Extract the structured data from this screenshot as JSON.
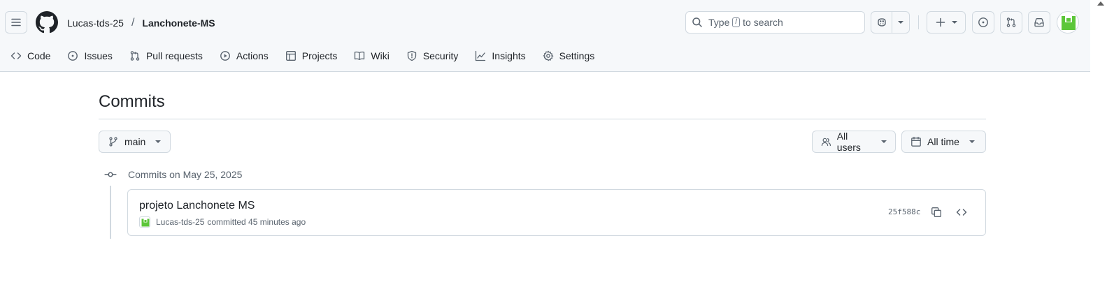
{
  "header": {
    "owner": "Lucas-tds-25",
    "separator": "/",
    "repo": "Lanchonete-MS",
    "search": {
      "prefix": "Type",
      "key": "/",
      "suffix": "to search"
    }
  },
  "tabs": [
    {
      "label": "Code",
      "icon": "code-icon"
    },
    {
      "label": "Issues",
      "icon": "issue-icon"
    },
    {
      "label": "Pull requests",
      "icon": "pull-request-icon"
    },
    {
      "label": "Actions",
      "icon": "play-icon"
    },
    {
      "label": "Projects",
      "icon": "table-icon"
    },
    {
      "label": "Wiki",
      "icon": "book-icon"
    },
    {
      "label": "Security",
      "icon": "shield-icon"
    },
    {
      "label": "Insights",
      "icon": "graph-icon"
    },
    {
      "label": "Settings",
      "icon": "gear-icon"
    }
  ],
  "page": {
    "title": "Commits"
  },
  "filters": {
    "branch": "main",
    "users": "All users",
    "time": "All time"
  },
  "groups": [
    {
      "label": "Commits on May 25, 2025",
      "commits": [
        {
          "message": "projeto Lanchonete MS",
          "author": "Lucas-tds-25",
          "meta": "committed 45 minutes ago",
          "sha": "25f588c"
        }
      ]
    }
  ],
  "colors": {
    "header_bg": "#f6f8fa",
    "border": "#d1d9e0",
    "muted_text": "#59636e",
    "avatar_green": "#5cc639"
  }
}
